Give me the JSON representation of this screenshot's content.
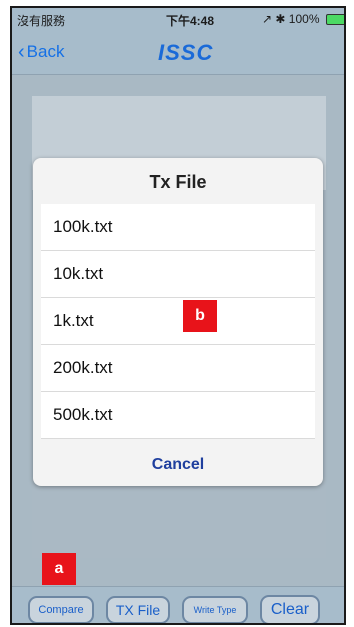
{
  "status_bar": {
    "carrier": "沒有服務",
    "time": "下午4:48",
    "location_bt": "↗ ✱",
    "battery_pct": "100%"
  },
  "nav": {
    "back_label": "Back",
    "title": "ISSC"
  },
  "dialog": {
    "title": "Tx File",
    "files": [
      "100k.txt",
      "10k.txt",
      "1k.txt",
      "200k.txt",
      "500k.txt"
    ],
    "cancel_label": "Cancel"
  },
  "annotations": {
    "a": "a",
    "b": "b"
  },
  "toolbar": {
    "compare_label": "Compare",
    "txfile_label": "TX File",
    "write_type_label": "Write Type",
    "clear_label": "Clear"
  },
  "colors": {
    "accent": "#1570e6",
    "annotation": "#e8131a",
    "background": "#a9b9c4"
  }
}
